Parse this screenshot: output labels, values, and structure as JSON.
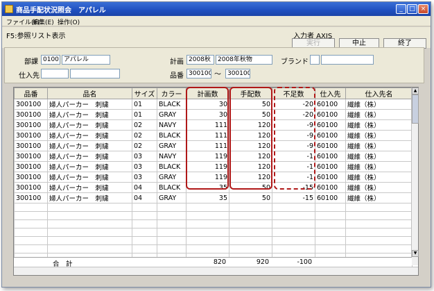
{
  "window": {
    "title": "商品手配状況照会　アパレル"
  },
  "menu": [
    "ファイル(F)",
    "編集(E)",
    "操作(O)"
  ],
  "toolbar": {
    "screen_label": "F5:参照リスト表示",
    "operator_label": "入力者 AXIS",
    "run_label": "実行",
    "stop_label": "中止",
    "exit_label": "終了"
  },
  "filters": {
    "dept_label": "部課",
    "dept_code": "0100",
    "dept_name": "アパレル",
    "plan_label": "計画",
    "plan_code": "2008秋",
    "plan_name": "2008年秋物",
    "brand_label": "ブランド",
    "brand_code": "",
    "brand_name": "",
    "supplier_label": "仕入先",
    "supplier_code": "",
    "supplier_name": "",
    "item_label": "品番",
    "item_from": "300100",
    "item_sep": "〜",
    "item_to": "300100"
  },
  "table": {
    "columns": [
      "品番",
      "品名",
      "サイズ",
      "カラー",
      "計画数",
      "手配数",
      "不足数",
      "仕入先",
      "仕入先名"
    ],
    "rows": [
      [
        "300100",
        "婦人パーカー　刺繍",
        "01",
        "BLACK",
        "30",
        "50",
        "-20",
        "60100",
        "繊維（株）"
      ],
      [
        "300100",
        "婦人パーカー　刺繍",
        "01",
        "GRAY",
        "30",
        "50",
        "-20",
        "60100",
        "繊維（株）"
      ],
      [
        "300100",
        "婦人パーカー　刺繍",
        "02",
        "NAVY",
        "111",
        "120",
        "-9",
        "60100",
        "繊維（株）"
      ],
      [
        "300100",
        "婦人パーカー　刺繍",
        "02",
        "BLACK",
        "111",
        "120",
        "-9",
        "60100",
        "繊維（株）"
      ],
      [
        "300100",
        "婦人パーカー　刺繍",
        "02",
        "GRAY",
        "111",
        "120",
        "-9",
        "60100",
        "繊維（株）"
      ],
      [
        "300100",
        "婦人パーカー　刺繍",
        "03",
        "NAVY",
        "119",
        "120",
        "-1",
        "60100",
        "繊維（株）"
      ],
      [
        "300100",
        "婦人パーカー　刺繍",
        "03",
        "BLACK",
        "119",
        "120",
        "-1",
        "60100",
        "繊維（株）"
      ],
      [
        "300100",
        "婦人パーカー　刺繍",
        "03",
        "GRAY",
        "119",
        "120",
        "-1",
        "60100",
        "繊維（株）"
      ],
      [
        "300100",
        "婦人パーカー　刺繍",
        "04",
        "BLACK",
        "35",
        "50",
        "-15",
        "60100",
        "繊維（株）"
      ],
      [
        "300100",
        "婦人パーカー　刺繍",
        "04",
        "GRAY",
        "35",
        "50",
        "-15",
        "60100",
        "繊維（株）"
      ]
    ],
    "total": {
      "label": "合　計",
      "plan": "820",
      "order": "920",
      "short": "-100"
    }
  },
  "highlight_color": "#b01818"
}
